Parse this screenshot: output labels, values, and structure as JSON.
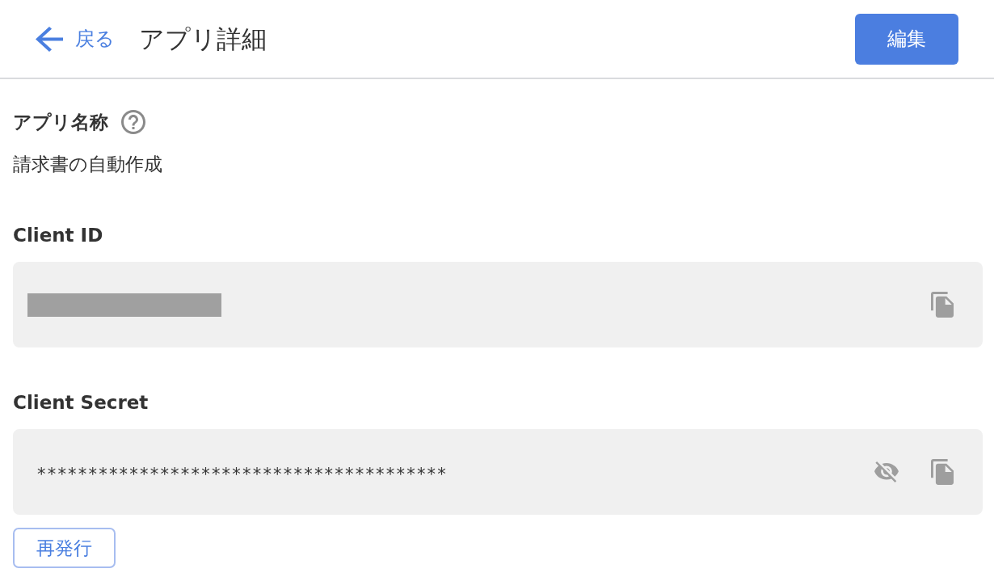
{
  "header": {
    "back_link": "戻る",
    "title": "アプリ詳細",
    "edit_button": "編集"
  },
  "fields": [
    {
      "kind": "plain",
      "label": "アプリ名称",
      "help": true,
      "value": "請求書の自動作成"
    },
    {
      "kind": "redacted",
      "label": "Client ID",
      "help": false
    },
    {
      "kind": "masked",
      "label": "Client Secret",
      "help": false,
      "value": "****************************************"
    }
  ],
  "reissue_button": "再発行"
}
